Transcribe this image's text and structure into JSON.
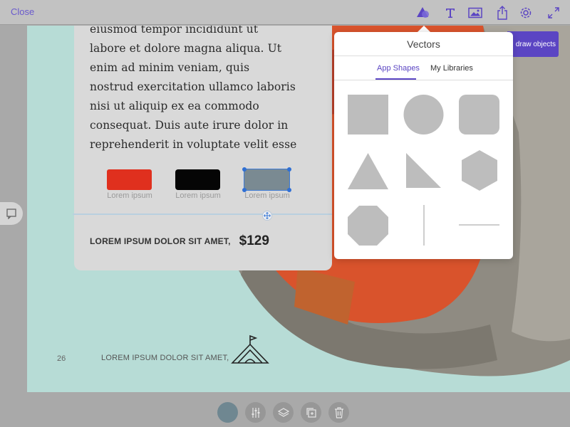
{
  "topbar": {
    "close_label": "Close",
    "icons": [
      "shapes-icon",
      "text-icon",
      "image-icon",
      "share-icon",
      "settings-icon",
      "fullscreen-icon"
    ]
  },
  "card": {
    "body_lines": [
      "eiusmod tempor incididunt ut",
      "labore et dolore magna aliqua. Ut",
      "enim ad minim veniam, quis",
      "nostrud exercitation ullamco laboris",
      "nisi ut aliquip ex ea commodo",
      "consequat. Duis aute irure dolor in",
      "reprehenderit in voluptate velit esse"
    ],
    "swatches": [
      {
        "color": "#e0301e",
        "label": "Lorem ipsum"
      },
      {
        "color": "#050505",
        "label": "Lorem ipsum"
      },
      {
        "color": "#7a8a92",
        "label": "Lorem ipsum"
      }
    ],
    "price_label": "LOREM IPSUM DOLOR SIT AMET,",
    "price": "$129"
  },
  "canvas": {
    "page_number": "26",
    "footer_text": "LOREM IPSUM DOLOR SIT AMET,"
  },
  "draw_button": {
    "label": "draw objects"
  },
  "popover": {
    "title": "Vectors",
    "tabs": [
      {
        "label": "App Shapes",
        "active": true
      },
      {
        "label": "My Libraries",
        "active": false
      }
    ],
    "shapes": [
      "square",
      "circle",
      "rounded-square",
      "triangle",
      "right-triangle",
      "hexagon",
      "octagon",
      "vertical-line",
      "horizontal-line"
    ]
  },
  "bottom_bar": {
    "color_swatch": "#6f8791",
    "icons": [
      "color-icon",
      "adjust-icon",
      "layers-icon",
      "duplicate-icon",
      "trash-icon"
    ]
  },
  "colors": {
    "accent": "#5b45c3",
    "canvas_bg": "#b7dcd6",
    "shape_fill": "#bdbdbd"
  }
}
